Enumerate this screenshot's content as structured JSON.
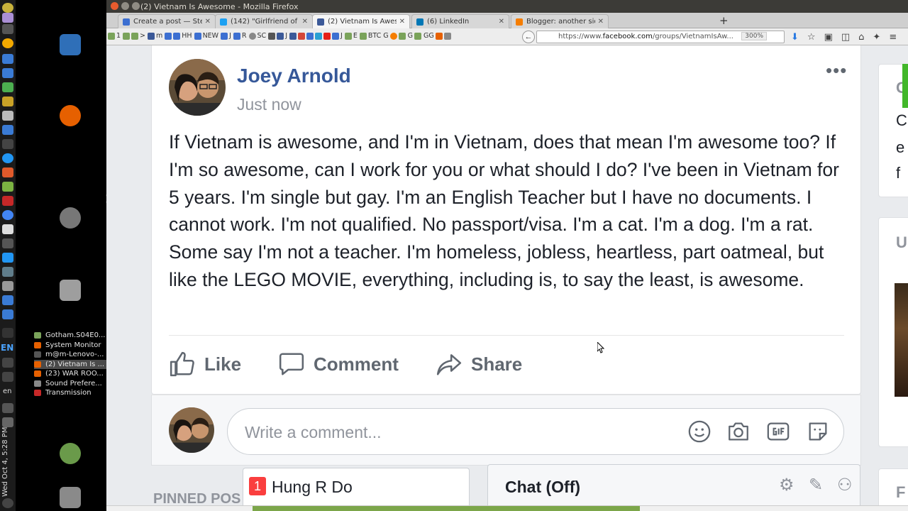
{
  "window": {
    "title": "(2) Vietnam Is Awesome - Mozilla Firefox"
  },
  "tabs": [
    {
      "label": "Create a post — Steem",
      "color": "#3c6fd1"
    },
    {
      "label": "(142) \"Girlfriend of Las",
      "color": "#1da1f2"
    },
    {
      "label": "(2) Vietnam Is Awesome",
      "color": "#3b5998",
      "active": true
    },
    {
      "label": "(6) LinkedIn",
      "color": "#0077b5"
    },
    {
      "label": "Blogger: another side",
      "color": "#f57d00"
    }
  ],
  "bookmarks": [
    "1",
    ">",
    "m",
    "HH",
    "NEW",
    "J",
    "R",
    "SC",
    "J",
    "J",
    "E",
    "BTC",
    "G",
    "G",
    "GG"
  ],
  "url": {
    "prefix": "https://www.",
    "host": "facebook.com",
    "path": "/groups/VietnamIsAw...",
    "zoom": "300%"
  },
  "dock_windows": [
    "Gotham.S04E0...",
    "System Monitor",
    "m@m-Lenovo-...",
    "(2) Vietnam Is ...",
    "(23) WAR ROO...",
    "Sound Prefere...",
    "Transmission"
  ],
  "system": {
    "language": "EN",
    "language_lower": "en",
    "clock": "Wed Oct 4, 5:28 PM"
  },
  "post": {
    "author": "Joey Arnold",
    "timestamp": "Just now",
    "text": "If Vietnam is awesome, and I'm in Vietnam, does that mean I'm awesome too? If I'm so awesome, can I work for you or what should I do? I've been in Vietnam for 5 years. I'm single but gay. I'm an English Teacher but I have no documents. I cannot work. I'm not qualified. No passport/visa. I'm a cat. I'm a dog. I'm a rat. Some say I'm not a teacher. I'm homeless, jobless, heartless, part oatmeal, but like the LEGO MOVIE, everything, including is, to say the least, is awesome.",
    "actions": {
      "like": "Like",
      "comment": "Comment",
      "share": "Share"
    }
  },
  "comment_box": {
    "placeholder": "Write a comment..."
  },
  "pinned_label": "PINNED POS",
  "chat": {
    "conversation": {
      "badge": "1",
      "name": "Hung R Do"
    },
    "status": "Chat (Off)"
  },
  "right_column": {
    "letters_top": [
      "G",
      "C",
      "e",
      "f"
    ],
    "letter_mid": "U",
    "letter_bottom": "F"
  },
  "colors": {
    "facebook_blue": "#365899",
    "badge_red": "#fa3e3e",
    "accent_green": "#42b72a"
  }
}
